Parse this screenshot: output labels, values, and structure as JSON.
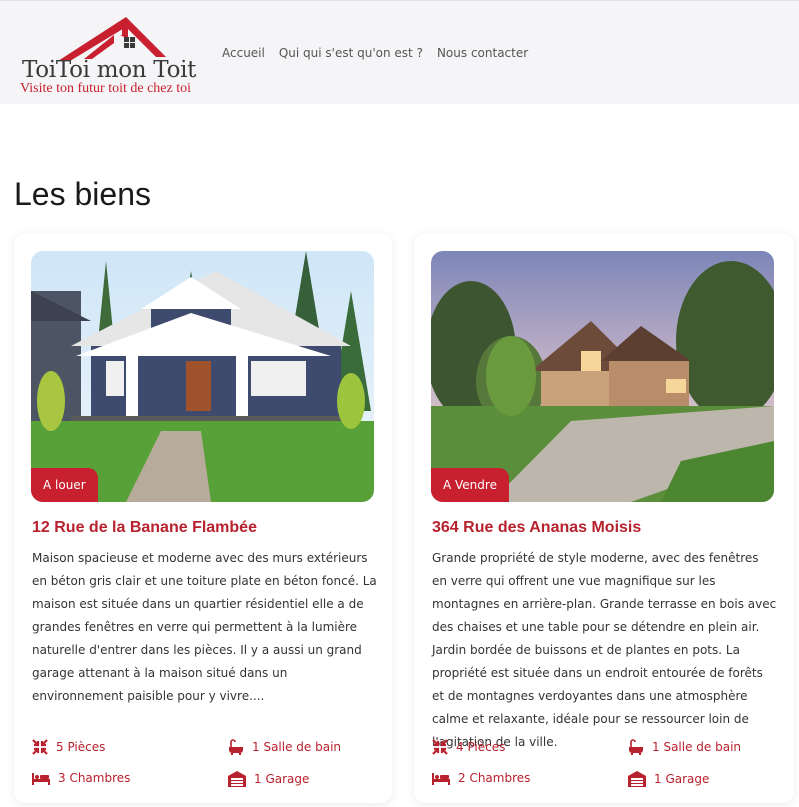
{
  "brand": {
    "title": "ToiToi mon Toit",
    "tagline": "Visite ton futur toit de chez toi",
    "colors": {
      "accent": "#c8202f",
      "header_bg": "#f5f5f7"
    }
  },
  "nav": {
    "items": [
      {
        "label": "Accueil"
      },
      {
        "label": "Qui qui s'est qu'on est ?"
      },
      {
        "label": "Nous contacter"
      }
    ]
  },
  "main": {
    "title": "Les biens",
    "listings": [
      {
        "badge": "A louer",
        "title": "12 Rue de la Banane Flambée",
        "description": "Maison spacieuse et moderne avec des murs extérieurs en béton gris clair et une toiture plate en béton foncé. La maison est située dans un quartier résidentiel elle a de grandes fenêtres en verre qui permettent à la lumière naturelle d'entrer dans les pièces. Il y a aussi un grand garage attenant à la maison situé dans un environnement paisible pour y vivre....",
        "features": {
          "rooms": "5 Pièces",
          "bathrooms": "1 Salle de bain",
          "bedrooms": "3 Chambres",
          "garage": "1 Garage"
        }
      },
      {
        "badge": "A Vendre",
        "title": "364 Rue des Ananas Moisis",
        "description": "Grande propriété de style moderne, avec des fenêtres en verre qui offrent une vue magnifique sur les montagnes en arrière-plan. Grande terrasse en bois avec des chaises et une table pour se détendre en plein air. Jardin bordée de buissons et de plantes en pots. La propriété est située dans un endroit entourée de forêts et de montagnes verdoyantes dans une atmosphère calme et relaxante, idéale pour se ressourcer loin de l'agitation de la ville.",
        "features": {
          "rooms": "4 Pièces",
          "bathrooms": "1 Salle de bain",
          "bedrooms": "2 Chambres",
          "garage": "1 Garage"
        }
      }
    ]
  }
}
